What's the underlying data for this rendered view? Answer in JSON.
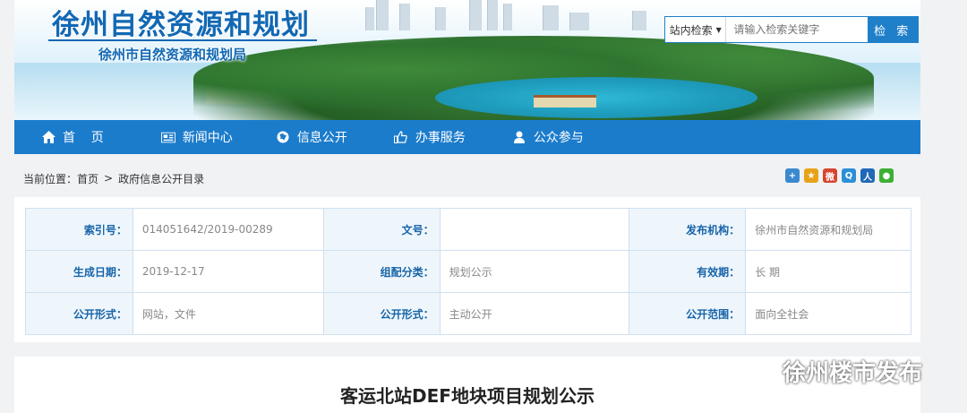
{
  "header": {
    "site_title": "徐州自然资源和规划",
    "site_subtitle": "徐州市自然资源和规划局"
  },
  "search": {
    "scope": "站内检索",
    "placeholder": "请输入检索关键字",
    "button": "检 索"
  },
  "nav": {
    "items": [
      {
        "label": "首    页",
        "icon": "home-icon"
      },
      {
        "label": "新闻中心",
        "icon": "news-icon"
      },
      {
        "label": "信息公开",
        "icon": "globe-icon"
      },
      {
        "label": "办事服务",
        "icon": "thumbs-up-icon"
      },
      {
        "label": "公众参与",
        "icon": "user-icon"
      }
    ]
  },
  "breadcrumb": {
    "prefix": "当前位置：",
    "items": [
      "首页",
      "政府信息公开目录"
    ],
    "separator": ">"
  },
  "share_icons": [
    "plus-icon",
    "star-icon",
    "weibo-icon",
    "qzone-icon",
    "renren-icon",
    "wechat-icon"
  ],
  "info": {
    "rows": [
      [
        {
          "label": "索引号：",
          "value": "014051642/2019-00289"
        },
        {
          "label": "文号：",
          "value": ""
        },
        {
          "label": "发布机构：",
          "value": "徐州市自然资源和规划局"
        }
      ],
      [
        {
          "label": "生成日期：",
          "value": "2019-12-17"
        },
        {
          "label": "组配分类：",
          "value": "规划公示"
        },
        {
          "label": "有效期：",
          "value": "长 期"
        }
      ],
      [
        {
          "label": "公开形式：",
          "value": "网站，文件"
        },
        {
          "label": "公开形式：",
          "value": "主动公开"
        },
        {
          "label": "公开范围：",
          "value": "面向全社会"
        }
      ]
    ]
  },
  "article": {
    "title": "客运北站DEF地块项目规划公示"
  },
  "watermark": {
    "text": "徐州楼市发布"
  },
  "colors": {
    "nav_bg": "#1c7ccc",
    "title_blue": "#1268b3",
    "label_blue": "#1764a8"
  }
}
